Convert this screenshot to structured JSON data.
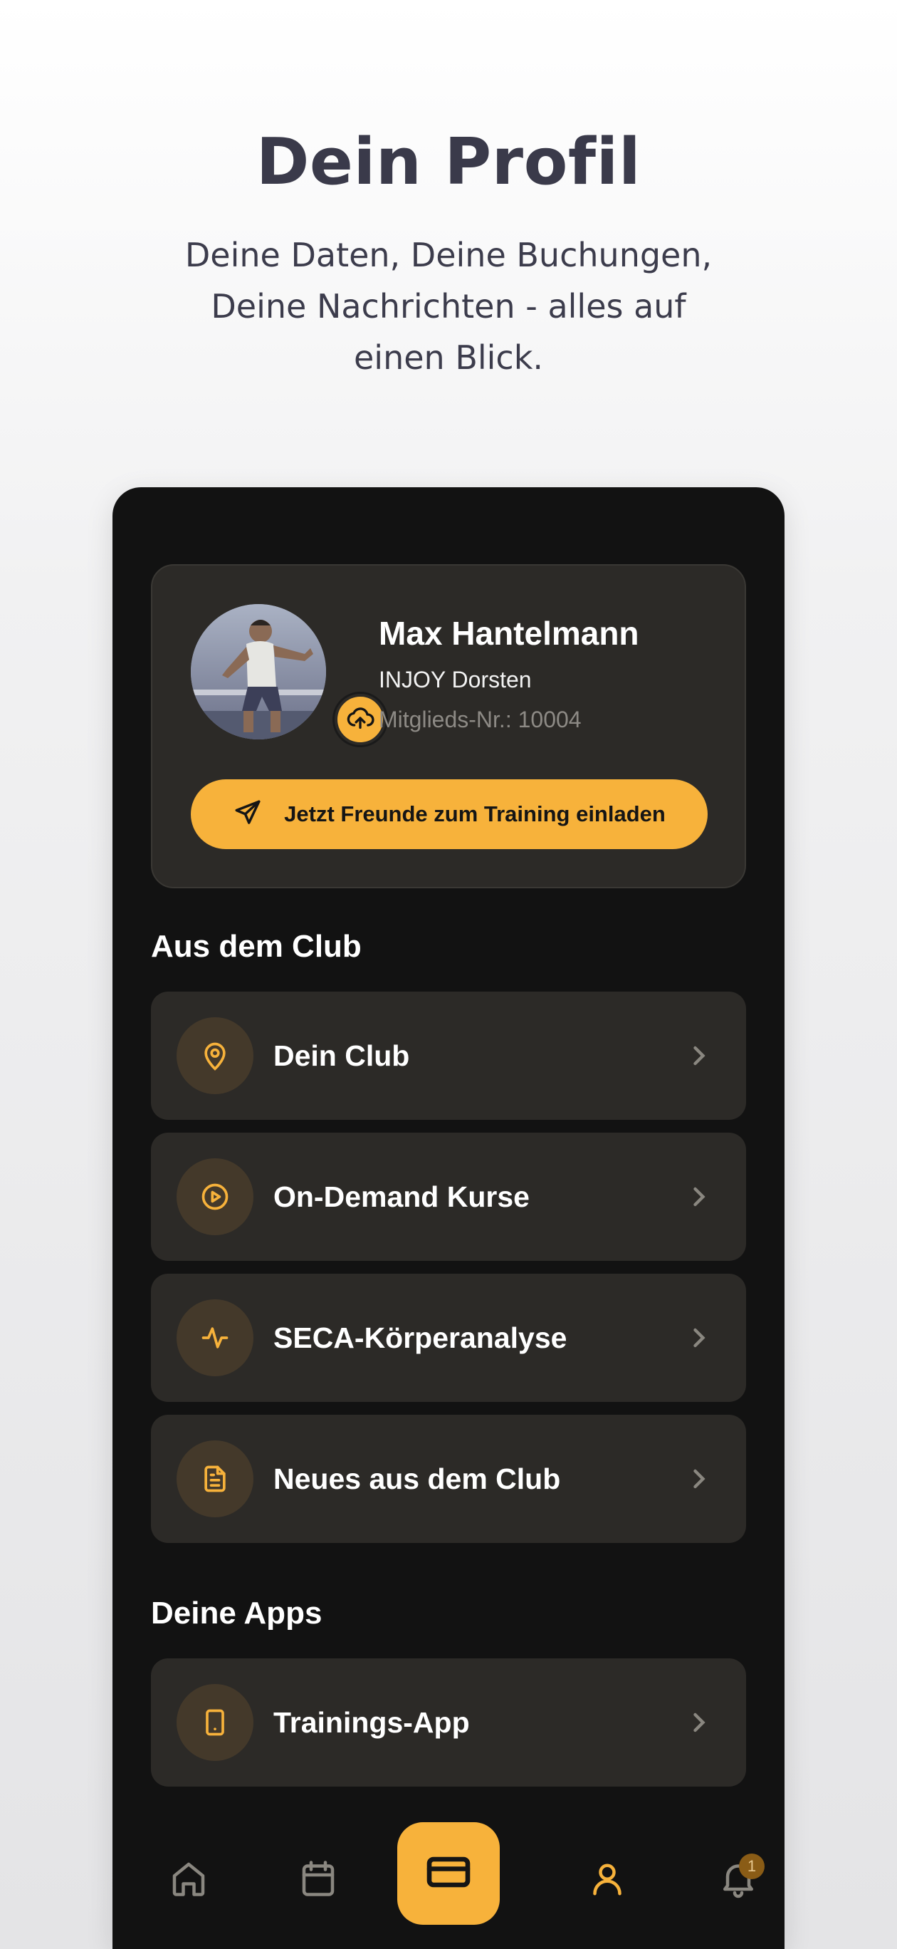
{
  "hero": {
    "title": "Dein Profil",
    "subtitle": "Deine Daten, Deine Buchungen, Deine Nachrichten - alles auf einen Blick."
  },
  "profile": {
    "name": "Max Hantelmann",
    "club": "INJOY Dorsten",
    "member_no": "Mitglieds-Nr.: 10004",
    "invite_label": "Jetzt Freunde zum Training einladen"
  },
  "sections": {
    "club_title": "Aus dem Club",
    "apps_title": "Deine Apps"
  },
  "club_items": [
    {
      "label": "Dein Club",
      "icon": "location-pin-icon"
    },
    {
      "label": "On-Demand Kurse",
      "icon": "play-circle-icon"
    },
    {
      "label": "SECA-Körperanalyse",
      "icon": "activity-icon"
    },
    {
      "label": "Neues aus dem Club",
      "icon": "document-icon"
    }
  ],
  "app_items": [
    {
      "label": "Trainings-App",
      "icon": "smartphone-icon"
    }
  ],
  "tabbar": {
    "tabs": [
      "home-icon",
      "calendar-icon",
      "card-icon",
      "user-icon",
      "bell-icon"
    ],
    "active": "user-icon",
    "notification_count": "1"
  },
  "colors": {
    "accent": "#f7b23b",
    "phone_bg": "#121212",
    "card_bg": "#2c2a27",
    "hero_text": "#3a3a4a"
  }
}
